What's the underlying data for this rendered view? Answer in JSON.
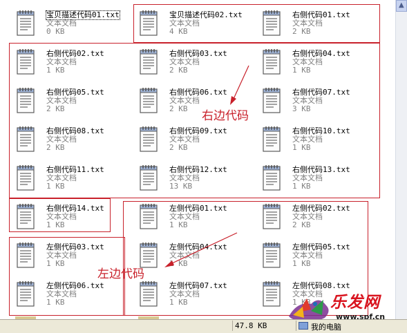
{
  "files": [
    {
      "name": "宝贝描述代码01.txt",
      "type": "文本文档",
      "size": "0 KB",
      "selected": true
    },
    {
      "name": "宝贝描述代码02.txt",
      "type": "文本文档",
      "size": "4 KB"
    },
    {
      "name": "右侧代码01.txt",
      "type": "文本文档",
      "size": "2 KB"
    },
    {
      "name": "右侧代码02.txt",
      "type": "文本文档",
      "size": "1 KB"
    },
    {
      "name": "右侧代码03.txt",
      "type": "文本文档",
      "size": "2 KB"
    },
    {
      "name": "右侧代码04.txt",
      "type": "文本文档",
      "size": "1 KB"
    },
    {
      "name": "右侧代码05.txt",
      "type": "文本文档",
      "size": "2 KB"
    },
    {
      "name": "右侧代码06.txt",
      "type": "文本文档",
      "size": "2 KB"
    },
    {
      "name": "右侧代码07.txt",
      "type": "文本文档",
      "size": "3 KB"
    },
    {
      "name": "右侧代码08.txt",
      "type": "文本文档",
      "size": "2 KB"
    },
    {
      "name": "右侧代码09.txt",
      "type": "文本文档",
      "size": "2 KB"
    },
    {
      "name": "右侧代码10.txt",
      "type": "文本文档",
      "size": "1 KB"
    },
    {
      "name": "右侧代码11.txt",
      "type": "文本文档",
      "size": "1 KB"
    },
    {
      "name": "右侧代码12.txt",
      "type": "文本文档",
      "size": "13 KB"
    },
    {
      "name": "右侧代码13.txt",
      "type": "文本文档",
      "size": "1 KB"
    },
    {
      "name": "右侧代码14.txt",
      "type": "文本文档",
      "size": "1 KB"
    },
    {
      "name": "左侧代码01.txt",
      "type": "文本文档",
      "size": "1 KB"
    },
    {
      "name": "左侧代码02.txt",
      "type": "文本文档",
      "size": "2 KB"
    },
    {
      "name": "左侧代码03.txt",
      "type": "文本文档",
      "size": "1 KB"
    },
    {
      "name": "左侧代码04.txt",
      "type": "文本文档",
      "size": "1 KB"
    },
    {
      "name": "左侧代码05.txt",
      "type": "文本文档",
      "size": "1 KB"
    },
    {
      "name": "左侧代码06.txt",
      "type": "文本文档",
      "size": "1 KB"
    },
    {
      "name": "左侧代码07.txt",
      "type": "文本文档",
      "size": "1 KB"
    },
    {
      "name": "左侧代码08.txt",
      "type": "文本文档",
      "size": "1 KB"
    }
  ],
  "annotations": {
    "right_label": "右边代码",
    "left_label": "左边代码"
  },
  "status": {
    "size": "47.8 KB",
    "location": "我的电脑"
  },
  "watermark": {
    "text": "乐发网",
    "url": "www.spf.cn"
  },
  "colors": {
    "annotation": "#c8202a"
  }
}
